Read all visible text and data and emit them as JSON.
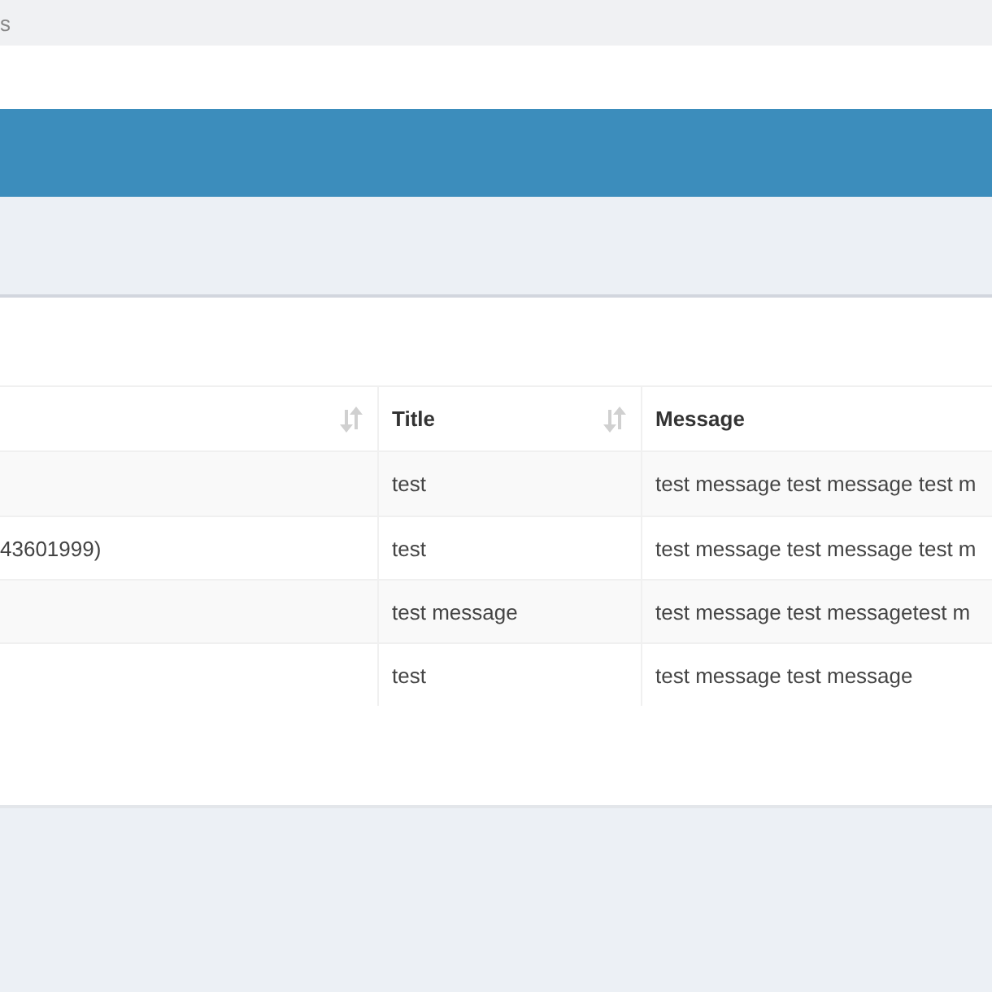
{
  "breadcrumb": "s",
  "table": {
    "columns": [
      {
        "sortable": true
      },
      {
        "label": "Title",
        "sortable": true
      },
      {
        "label": "Message",
        "sortable": false
      }
    ],
    "rows": [
      [
        "",
        "test",
        "test message test message test m"
      ],
      [
        "43601999)",
        "test",
        "test message test message test m"
      ],
      [
        "",
        "test message",
        "test message test messagetest m"
      ],
      [
        "",
        "test",
        "test message test message"
      ]
    ]
  }
}
